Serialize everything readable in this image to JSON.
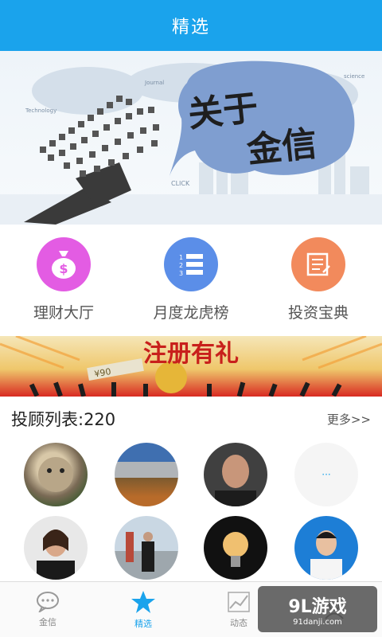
{
  "header": {
    "title": "精选"
  },
  "banner": {
    "headline_line1": "关于",
    "headline_line2": "金信",
    "tags": [
      "Technology",
      "Journal",
      "science",
      "CLICK"
    ]
  },
  "quick_links": [
    {
      "label": "理财大厅",
      "icon": "money-bag-icon",
      "color": "#e35ce3"
    },
    {
      "label": "月度龙虎榜",
      "icon": "numbered-list-icon",
      "color": "#5b8ee8"
    },
    {
      "label": "投资宝典",
      "icon": "document-icon",
      "color": "#f28a5c"
    }
  ],
  "promo": {
    "text": "注册有礼",
    "amount": "¥90"
  },
  "advisors": {
    "title": "投顾列表:220",
    "more": "更多>>",
    "more_icon": "···"
  },
  "tabs": [
    {
      "label": "金信",
      "icon": "chat-bubble-icon"
    },
    {
      "label": "精选",
      "icon": "star-icon",
      "active": true
    },
    {
      "label": "动态",
      "icon": "chart-icon"
    },
    {
      "label": "",
      "icon": "user-icon"
    }
  ],
  "watermark": {
    "brand": "9L游戏",
    "site": "91danji.com"
  },
  "colors": {
    "accent": "#1aa3ec"
  }
}
